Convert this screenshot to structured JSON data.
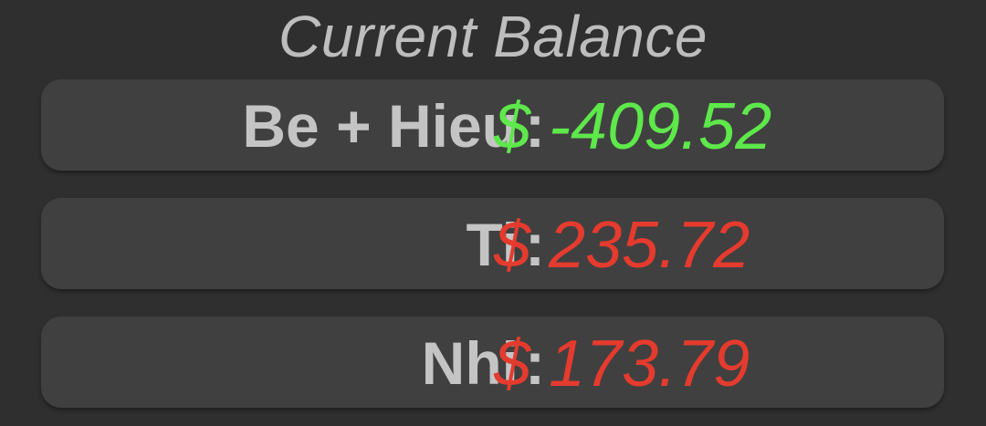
{
  "header": {
    "title": "Current Balance"
  },
  "balances": [
    {
      "name": "Be + Hieu",
      "separator": ":",
      "amount": "$ -409.52",
      "amount_color": "#5ee84b"
    },
    {
      "name": "Ti",
      "separator": ":",
      "amount": "$ 235.72",
      "amount_color": "#e53b2e"
    },
    {
      "name": "Nhi",
      "separator": ":",
      "amount": "$ 173.79",
      "amount_color": "#e53b2e"
    }
  ]
}
